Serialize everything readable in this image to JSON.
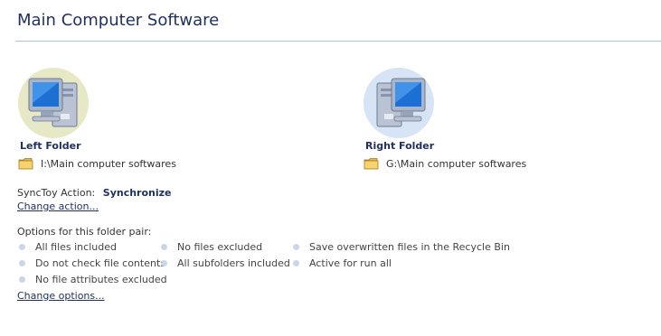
{
  "header": {
    "title": "Main Computer Software"
  },
  "left_folder": {
    "heading": "Left Folder",
    "path": "I:\\Main computer softwares",
    "icon": "computer-icon"
  },
  "right_folder": {
    "heading": "Right Folder",
    "path": "G:\\Main computer softwares",
    "icon": "computer-icon"
  },
  "action": {
    "label": "SyncToy Action:",
    "value": "Synchronize",
    "change_link": "Change action..."
  },
  "options": {
    "heading": "Options for this folder pair:",
    "items": [
      "All files included",
      "No files excluded",
      "Save overwritten files in the Recycle Bin",
      "Do not check file contents",
      "All subfolders included",
      "Active for run all",
      "No file attributes excluded"
    ],
    "change_link": "Change options..."
  },
  "colors": {
    "title": "#1f2f5f",
    "rule": "#a9c3e6",
    "left_halo": "#e7e8c6",
    "right_halo": "#d7e4f6",
    "bullet": "#c9d6e8"
  }
}
